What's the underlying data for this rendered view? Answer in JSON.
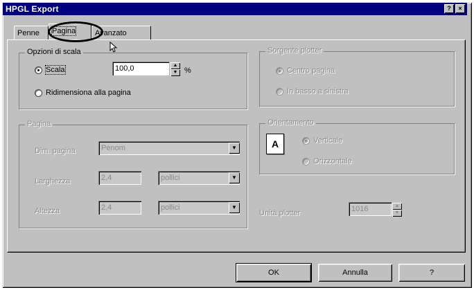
{
  "window": {
    "title": "HPGL Export",
    "help_icon": "?",
    "close_icon": "×"
  },
  "tabs": [
    {
      "label": "Penne"
    },
    {
      "label": "Pagina"
    },
    {
      "label": "Avanzato"
    }
  ],
  "scale_options": {
    "legend": "Opzioni di scala",
    "scale_label": "Scala",
    "scale_value": "100,0",
    "scale_unit": "%",
    "fit_label": "Ridimensiona alla pagina"
  },
  "plotter_source": {
    "legend": "Sorgente plotter",
    "center_label": "Centro pagina",
    "bottom_left_label": "In basso a sinistra"
  },
  "page": {
    "legend": "Pagina",
    "size_label": "Dim. pagina",
    "size_value": "Penom",
    "width_label": "Larghezza",
    "width_value": "2,4",
    "width_unit": "pollici",
    "height_label": "Altezza",
    "height_value": "2,4",
    "height_unit": "pollici"
  },
  "orientation": {
    "legend": "Orientamento",
    "icon_letter": "A",
    "portrait_label": "Verticale",
    "landscape_label": "Orizzontale"
  },
  "plotter_unit": {
    "label": "Unità plotter",
    "value": "1016"
  },
  "buttons": {
    "ok": "OK",
    "cancel": "Annulla",
    "help": "?"
  }
}
